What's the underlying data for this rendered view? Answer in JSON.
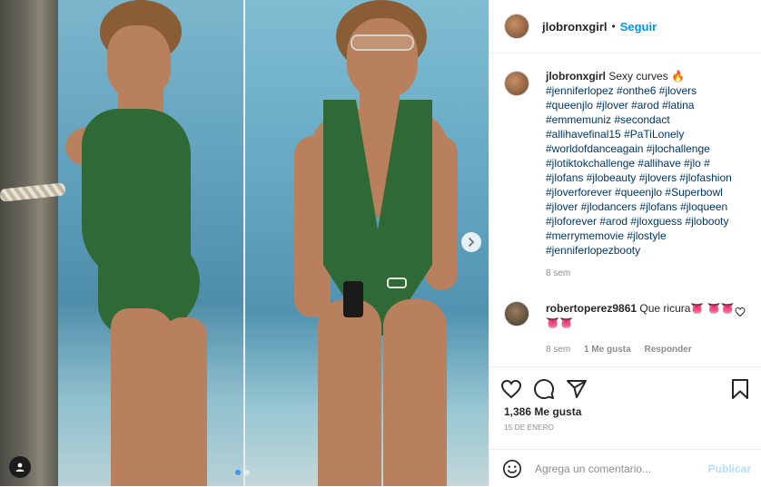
{
  "post": {
    "author": "jlobronxgirl",
    "header_separator": "•",
    "follow_label": "Seguir"
  },
  "caption": {
    "username": "jlobronxgirl",
    "text": "Sexy curves 🔥",
    "hashtags": "#jenniferlopez #onthe6 #jlovers #queenjlo #jlover #arod #latina #emmemuniz #secondact #allihavefinal15 #PaTiLonely #worldofdanceagain #jlochallenge #jlotiktokchallenge #allihave #jlo # #jlofans #jlobeauty #jlovers #jlofashion #jloverforever #queenjlo #Superbowl #jlover #jlodancers #jlofans #jloqueen #jloforever #arod #jloxguess #jlobooty #merrymemovie #jlostyle #jenniferlopezbooty",
    "age": "8 sem"
  },
  "comment": {
    "username": "robertoperez9861",
    "text": "Que ricura👅 👅👅👅👅",
    "age": "8 sem",
    "likes": "1 Me gusta",
    "reply_label": "Responder"
  },
  "stats": {
    "likes": "1,386 Me gusta",
    "date": "15 DE ENERO"
  },
  "composer": {
    "placeholder": "Agrega un comentario...",
    "publish_label": "Publicar"
  },
  "carousel": {
    "total": 2,
    "active_index": 1
  },
  "colors": {
    "link_blue": "#0095f6",
    "hashtag_blue": "#00376b",
    "muted": "#8e8e8e",
    "publish_disabled": "#b2dffc"
  },
  "icons": {
    "like": "heart-icon",
    "comment": "comment-icon",
    "share": "paper-plane-icon",
    "save": "bookmark-icon",
    "emoji": "smiley-icon",
    "next": "chevron-right-icon",
    "tags": "user-tag-icon"
  }
}
